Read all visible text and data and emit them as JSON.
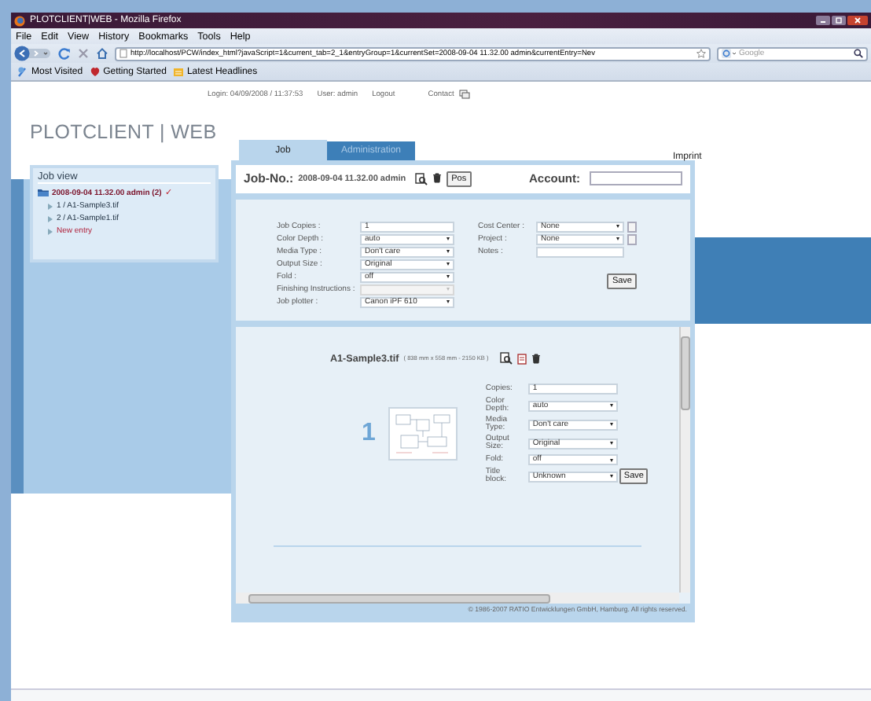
{
  "browser": {
    "title": "PLOTCLIENT|WEB - Mozilla Firefox",
    "menu": [
      "File",
      "Edit",
      "View",
      "History",
      "Bookmarks",
      "Tools",
      "Help"
    ],
    "url": "http://localhost/PCW/index_html?javaScript=1&current_tab=2_1&entryGroup=1&currentSet=2008-09-04 11.32.00 admin&currentEntry=Nev",
    "search_placeholder": "Google",
    "bookmarks": [
      "Most Visited",
      "Getting Started",
      "Latest Headlines"
    ]
  },
  "header": {
    "login": "Login: 04/09/2008 / 11:37:53",
    "user": "User: admin",
    "logout": "Logout",
    "contact": "Contact"
  },
  "logo": "PLOTCLIENT | WEB",
  "imprint": "Imprint",
  "job_view": {
    "title": "Job view",
    "tree": [
      {
        "label": "2008-09-04 11.32.00 admin (2)",
        "status": "✓",
        "expanded": true,
        "children": [
          {
            "label": "1 / A1-Sample3.tif",
            "kind": "file"
          },
          {
            "label": "2 / A1-Sample1.tif",
            "kind": "file"
          },
          {
            "label": "New entry",
            "kind": "new"
          }
        ]
      }
    ]
  },
  "tabs": [
    {
      "label": "Job",
      "selected": true
    },
    {
      "label": "Administration",
      "selected": false
    }
  ],
  "job": {
    "label": "Job-No.:",
    "number": "2008-09-04 11.32.00 admin",
    "pos_button": "Pos",
    "account_label": "Account:"
  },
  "form_left": [
    {
      "label": "Job Copies :",
      "kind": "text",
      "value": "1"
    },
    {
      "label": "Color Depth :",
      "kind": "select",
      "value": "auto"
    },
    {
      "label": "Media Type :",
      "kind": "select",
      "value": "Don't care"
    },
    {
      "label": "Output Size :",
      "kind": "select",
      "value": "Original"
    },
    {
      "label": "Fold :",
      "kind": "select",
      "value": "off"
    },
    {
      "label": "Finishing Instructions :",
      "kind": "select",
      "disabled": true
    },
    {
      "label": "Job plotter :",
      "kind": "select",
      "value": "Canon iPF 610"
    }
  ],
  "form_right": [
    {
      "label": "Cost Center :",
      "kind": "select",
      "value": "None"
    },
    {
      "label": "Project :",
      "kind": "select",
      "value": "None"
    },
    {
      "label": "Notes :",
      "kind": "text"
    }
  ],
  "save": "Save",
  "file": {
    "name": "A1-Sample3.tif",
    "info": "( 838 mm x 558 mm - 2150 KB )",
    "index": "1",
    "fields": [
      {
        "label": "Copies:",
        "kind": "text",
        "value": "1"
      },
      {
        "label": "Color Depth:",
        "kind": "select",
        "value": "auto"
      },
      {
        "label": "Media Type:",
        "kind": "select",
        "value": "Don't care"
      },
      {
        "label": "Output Size:",
        "kind": "select",
        "value": "Original"
      },
      {
        "label": "Fold:",
        "kind": "select",
        "value": "off"
      },
      {
        "label": "Title block:",
        "kind": "select",
        "value": "Unknown"
      }
    ],
    "save": "Save"
  },
  "footer": "© 1986-2007 RATIO Entwicklungen GmbH, Hamburg. All rights reserved."
}
